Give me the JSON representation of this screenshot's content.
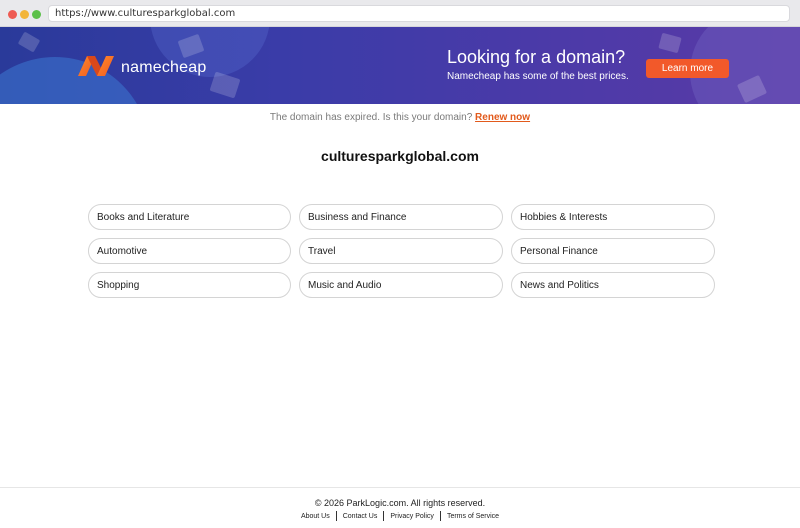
{
  "browser": {
    "url": "https://www.culturesparkglobal.com"
  },
  "banner": {
    "brand": "namecheap",
    "title": "Looking for a domain?",
    "subtitle": "Namecheap has some of the best prices.",
    "cta_label": "Learn more",
    "colors": {
      "accent": "#f2592a",
      "background": "#3a3ca8"
    }
  },
  "notice": {
    "text": "The domain has expired. Is this your domain?",
    "link_label": "Renew now"
  },
  "domain": {
    "name": "culturesparkglobal.com"
  },
  "categories": [
    "Books and Literature",
    "Business and Finance",
    "Hobbies & Interests",
    "Automotive",
    "Travel",
    "Personal Finance",
    "Shopping",
    "Music and Audio",
    "News and Politics"
  ],
  "footer": {
    "copyright": "© 2026 ParkLogic.com. All rights reserved.",
    "links": [
      "About Us",
      "Contact Us",
      "Privacy Policy",
      "Terms of Service"
    ]
  }
}
